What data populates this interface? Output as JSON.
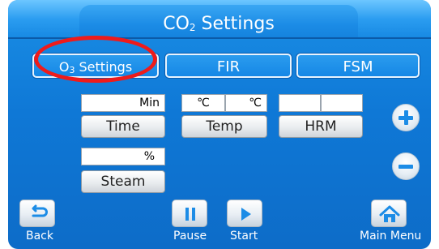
{
  "header": {
    "title_prefix": "CO",
    "title_sub": "2",
    "title_suffix": " Settings"
  },
  "options": {
    "o3_prefix": "O",
    "o3_sub": "3",
    "o3_suffix": " Settings",
    "fir": "FIR",
    "fsm": "FSM"
  },
  "fields": {
    "time_value": "Min",
    "temp_value_1": "℃",
    "temp_value_2": "℃",
    "hrm_value_1": "",
    "hrm_value_2": "",
    "steam_value": "%"
  },
  "buttons": {
    "time": "Time",
    "temp": "Temp",
    "hrm": "HRM",
    "steam": "Steam"
  },
  "nav": {
    "back": "Back",
    "pause": "Pause",
    "start": "Start",
    "main_menu": "Main Menu"
  },
  "colors": {
    "screen_blue": "#1587e6",
    "highlight_red": "#ee1b1b",
    "icon_blue": "#1c8ce6"
  },
  "icons": {
    "back": "back-arrow-icon",
    "pause": "pause-icon",
    "start": "play-icon",
    "main_menu": "home-icon",
    "increase": "plus-icon",
    "decrease": "minus-icon"
  }
}
